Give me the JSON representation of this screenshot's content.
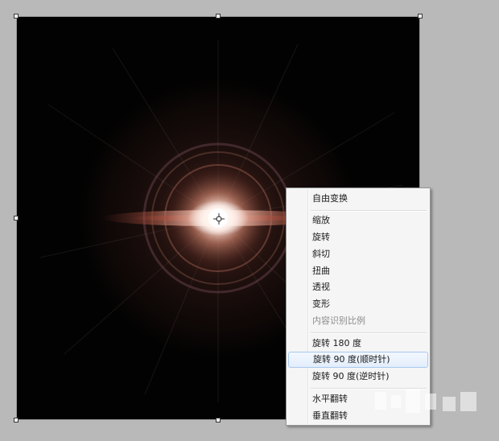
{
  "context_menu": {
    "items": [
      {
        "label": "自由变换",
        "enabled": true
      },
      {
        "label": "缩放",
        "enabled": true
      },
      {
        "label": "旋转",
        "enabled": true
      },
      {
        "label": "斜切",
        "enabled": true
      },
      {
        "label": "扭曲",
        "enabled": true
      },
      {
        "label": "透视",
        "enabled": true
      },
      {
        "label": "变形",
        "enabled": true
      },
      {
        "label": "内容识别比例",
        "enabled": false
      },
      {
        "label": "旋转 180 度",
        "enabled": true
      },
      {
        "label": "旋转 90 度(顺时针)",
        "enabled": true,
        "highlighted": true
      },
      {
        "label": "旋转 90 度(逆时针)",
        "enabled": true
      },
      {
        "label": "水平翻转",
        "enabled": true
      },
      {
        "label": "垂直翻转",
        "enabled": true
      }
    ]
  },
  "colors": {
    "workspace": "#b9b9b9",
    "canvas": "#020202",
    "flare_core": "#ffffff",
    "flare_glow": "#e8a08a",
    "flare_ring": "#b06a5a",
    "menu_bg": "#f5f5f5",
    "menu_highlight_border": "#a8c8f1",
    "menu_disabled_text": "#8c8c8c"
  },
  "icons": {
    "pivot": "crosshair-icon"
  }
}
